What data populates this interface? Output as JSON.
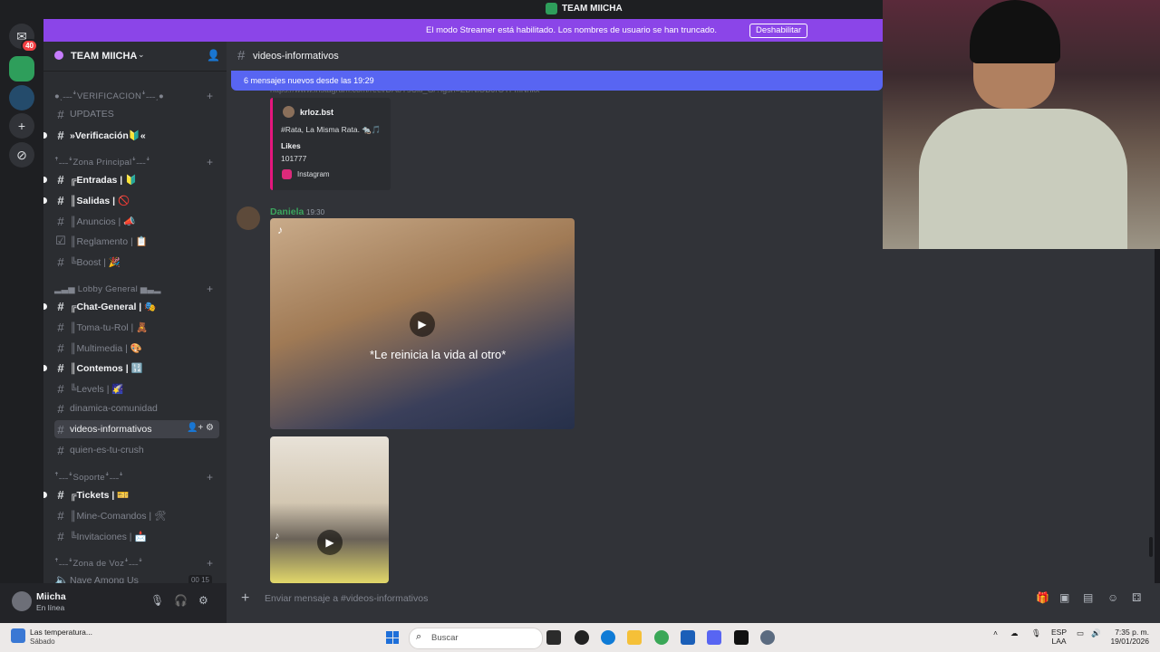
{
  "window": {
    "title": "TEAM MIICHA"
  },
  "rail": {
    "dm_badge": "40"
  },
  "banner": {
    "text": "El modo Streamer está habilitado. Los nombres de usuario se han truncado.",
    "button": "Deshabilitar"
  },
  "server": {
    "name": "TEAM MIICHA"
  },
  "sidebar": {
    "categories": [
      "●ˎ˗˗˗ꜜVERIFICACIONꜜ˗˗˗ˏ●",
      "ꜛ˗˗˗ꜜZona Principalꜜ˗˗˗ꜜ",
      "▂▃▅ Lobby General ▅▃▂",
      "ꜛ˗˗˗ꜜSoporteꜜ˗˗˗ꜜ",
      "ꜛ˗˗˗ꜜZona de Vozꜜ˗˗˗ꜜ"
    ],
    "channels": [
      {
        "label": "UPDATES"
      },
      {
        "label": "»Verificación🔰«"
      },
      {
        "label": "╔Entradas | 🔰"
      },
      {
        "label": "║Salidas | 🚫"
      },
      {
        "label": "║Anuncios | 📣"
      },
      {
        "label": "║Reglamento | 📋"
      },
      {
        "label": "╚Boost | 🎉"
      },
      {
        "label": "╔Chat-General | 🎭"
      },
      {
        "label": "║Toma-tu-Rol | 🧸"
      },
      {
        "label": "║Multimedia | 🎨"
      },
      {
        "label": "║Contemos | 🔢"
      },
      {
        "label": "╚Levels | 🌠"
      },
      {
        "label": "dinamica-comunidad"
      },
      {
        "label": "videos-informativos"
      },
      {
        "label": "quien-es-tu-crush"
      },
      {
        "label": "╔Tickets | 🎫"
      },
      {
        "label": "║Mine-Comandos | 🛠"
      },
      {
        "label": "╚Invitaciones | 📩"
      },
      {
        "label": "Nave Among Us",
        "count_a": "00",
        "count_b": "15"
      }
    ]
  },
  "user": {
    "name": "Miicha",
    "status": "En línea"
  },
  "chat": {
    "channel": "videos-informativos",
    "new_messages": "6 mensajes nuevos desde las 19:29",
    "link_fragment": "https://www.instagram.com/reel/DAbYsCkl_G/?igsh=ZDNlODJrOTFmNnkx",
    "embed": {
      "author": "krloz.bst",
      "description": "#Rata, La Misma Rata. 🐀🎵",
      "field_label": "Likes",
      "field_value": "101777",
      "footer": "Instagram"
    },
    "message": {
      "author": "Daniela",
      "time": "19:30",
      "video_caption": "*Le reinicia la vida al otro*"
    },
    "composer_placeholder": "Enviar mensaje a #videos-informativos"
  },
  "taskbar": {
    "weather_title": "Las temperatura...",
    "weather_sub": "Sábado",
    "search_label": "Buscar",
    "lang_1": "ESP",
    "lang_2": "LAA",
    "time": "7:35 p. m.",
    "date": "19/01/2026"
  },
  "colors": {
    "accent": "#5865f2",
    "banner": "#8b45e8",
    "online": "#3ba55d",
    "instagram": "#e4167d"
  }
}
